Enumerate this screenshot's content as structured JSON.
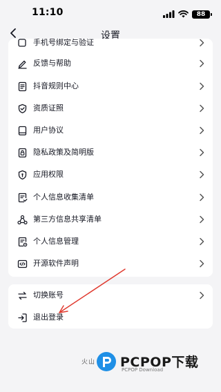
{
  "status_bar": {
    "time": "11:10",
    "battery": "88"
  },
  "header": {
    "title": "设置"
  },
  "main_list": {
    "items": [
      {
        "label": "手机号绑定与验证",
        "icon": "partial-icon"
      },
      {
        "label": "反馈与帮助",
        "icon": "pencil-icon"
      },
      {
        "label": "抖音规则中心",
        "icon": "document-list-icon"
      },
      {
        "label": "资质证照",
        "icon": "shield-check-icon"
      },
      {
        "label": "用户协议",
        "icon": "book-icon"
      },
      {
        "label": "隐私政策及简明版",
        "icon": "lock-icon"
      },
      {
        "label": "应用权限",
        "icon": "shield-lock-icon"
      },
      {
        "label": "个人信息收集清单",
        "icon": "checklist-icon"
      },
      {
        "label": "第三方信息共享清单",
        "icon": "share-nodes-icon"
      },
      {
        "label": "个人信息管理",
        "icon": "profile-settings-icon"
      },
      {
        "label": "开源软件声明",
        "icon": "code-icon"
      }
    ]
  },
  "account_list": {
    "items": [
      {
        "label": "切换账号",
        "icon": "swap-icon"
      },
      {
        "label": "退出登录",
        "icon": "logout-icon"
      }
    ]
  },
  "footer": {
    "text": "火山"
  },
  "watermark": {
    "brand": "PCPOP下载",
    "sub": "PCPOP Download"
  },
  "colors": {
    "background": "#f4f4f6",
    "card": "#ffffff",
    "text": "#161823",
    "annotation_arrow": "#e03a2f",
    "watermark_blue": "#1f8fe6"
  }
}
